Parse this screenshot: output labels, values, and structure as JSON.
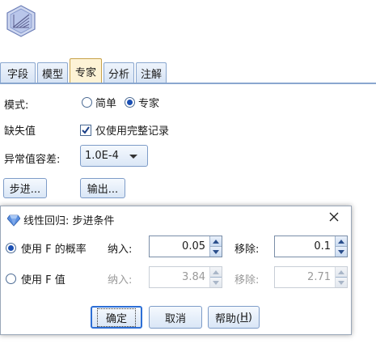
{
  "tabs": [
    {
      "label": "字段",
      "active": false
    },
    {
      "label": "模型",
      "active": false
    },
    {
      "label": "专家",
      "active": true
    },
    {
      "label": "分析",
      "active": false
    },
    {
      "label": "注解",
      "active": false
    }
  ],
  "mode": {
    "label": "模式:",
    "options": [
      "简单",
      "专家"
    ],
    "selected": "专家"
  },
  "missing": {
    "label": "缺失值",
    "checkbox_label": "仅使用完整记录",
    "checked": true
  },
  "singularity": {
    "label": "异常值容差:",
    "value": "1.0E-4"
  },
  "buttons": {
    "stepping": "步进...",
    "output": "输出..."
  },
  "dialog": {
    "title": "线性回归: 步进条件",
    "rows": [
      {
        "option": "使用 F 的概率",
        "selected": true,
        "entry_label": "纳入:",
        "entry_value": "0.05",
        "removal_label": "移除:",
        "removal_value": "0.1",
        "enabled": true
      },
      {
        "option": "使用 F 值",
        "selected": false,
        "entry_label": "纳入:",
        "entry_value": "3.84",
        "removal_label": "移除:",
        "removal_value": "2.71",
        "enabled": false
      }
    ],
    "ok": "确定",
    "cancel": "取消",
    "help_prefix": "帮助(",
    "help_key": "H",
    "help_suffix": ")"
  },
  "colors": {
    "accent": "#2d6fd6",
    "tab_active": "#fdf3d6",
    "tab_border": "#8aa7cf"
  }
}
